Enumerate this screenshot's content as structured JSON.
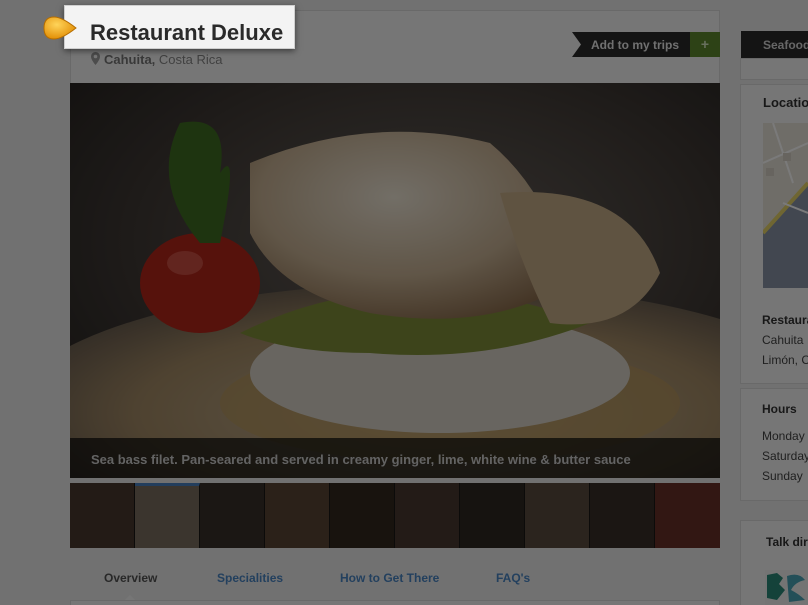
{
  "header": {
    "title": "Restaurant Deluxe",
    "location_city": "Cahuita,",
    "location_country": "Costa Rica",
    "add_trips_label": "Add to my trips",
    "add_trips_plus": "+"
  },
  "hero": {
    "caption": "Sea bass filet. Pan-seared and served in creamy ginger, lime, white wine & butter sauce"
  },
  "tabs": [
    {
      "label": "Overview"
    },
    {
      "label": "Specialities"
    },
    {
      "label": "How to Get There"
    },
    {
      "label": "FAQ's"
    }
  ],
  "sidebar": {
    "category_tab": "Seafood",
    "location_heading": "Location",
    "address_name": "Restaurant",
    "address_line1": "Cahuita",
    "address_line2": "Limón, C",
    "hours_heading": "Hours",
    "hours_days": [
      "Monday",
      "Saturday",
      "Sunday"
    ],
    "talk_heading": "Talk dir"
  },
  "colors": {
    "accent_blue": "#4a86c5",
    "plus_green": "#5f8a2e",
    "pointer_orange": "#f2a20c"
  }
}
